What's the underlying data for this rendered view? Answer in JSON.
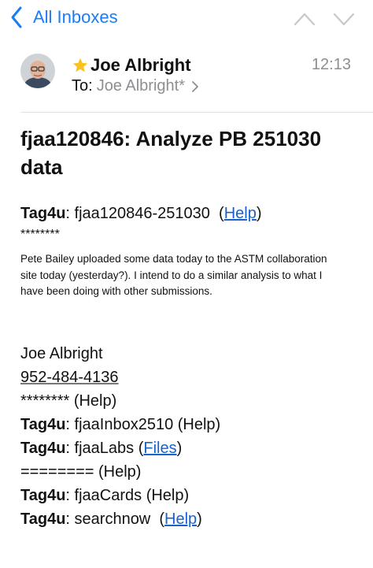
{
  "nav": {
    "back_label": "All Inboxes",
    "back_icon": "chevron-left-icon",
    "prev_icon": "chevron-up-icon",
    "next_icon": "chevron-down-icon",
    "accent": "#1a7cf6"
  },
  "message": {
    "sender": "Joe Albright",
    "time": "12:13",
    "to_prefix": "To:",
    "to_name": "Joe Albright*",
    "subject": "fjaa120846: Analyze PB 251030 data",
    "star_color": "#f8c31c"
  },
  "body": {
    "tag_label": "Tag4u",
    "tag_value": ": fjaa120846-251030",
    "help_open": "(",
    "help_link": "Help",
    "help_close": ")",
    "stars": "********",
    "paragraph": "Pete Bailey uploaded some data today to the ASTM collaboration site today (yesterday?). I intend to do a similar analysis to what I have been doing with other submissions."
  },
  "signature": {
    "name": "Joe Albright",
    "phone": "952-484-4136",
    "stars_line": "******** (Help)",
    "tag1_label": "Tag4u",
    "tag1_value": ": fjaaInbox2510 (Help)",
    "tag2_label": "Tag4u",
    "tag2_value": ": fjaaLabs (",
    "tag2_link": "Files",
    "tag2_close": ")",
    "equals_line": "======== (Help)",
    "tag3_label": "Tag4u",
    "tag3_value": ": fjaaCards (Help)",
    "tag4_label": "Tag4u",
    "tag4_value": ": searchnow  (",
    "tag4_link": "Help",
    "tag4_close": ")"
  }
}
